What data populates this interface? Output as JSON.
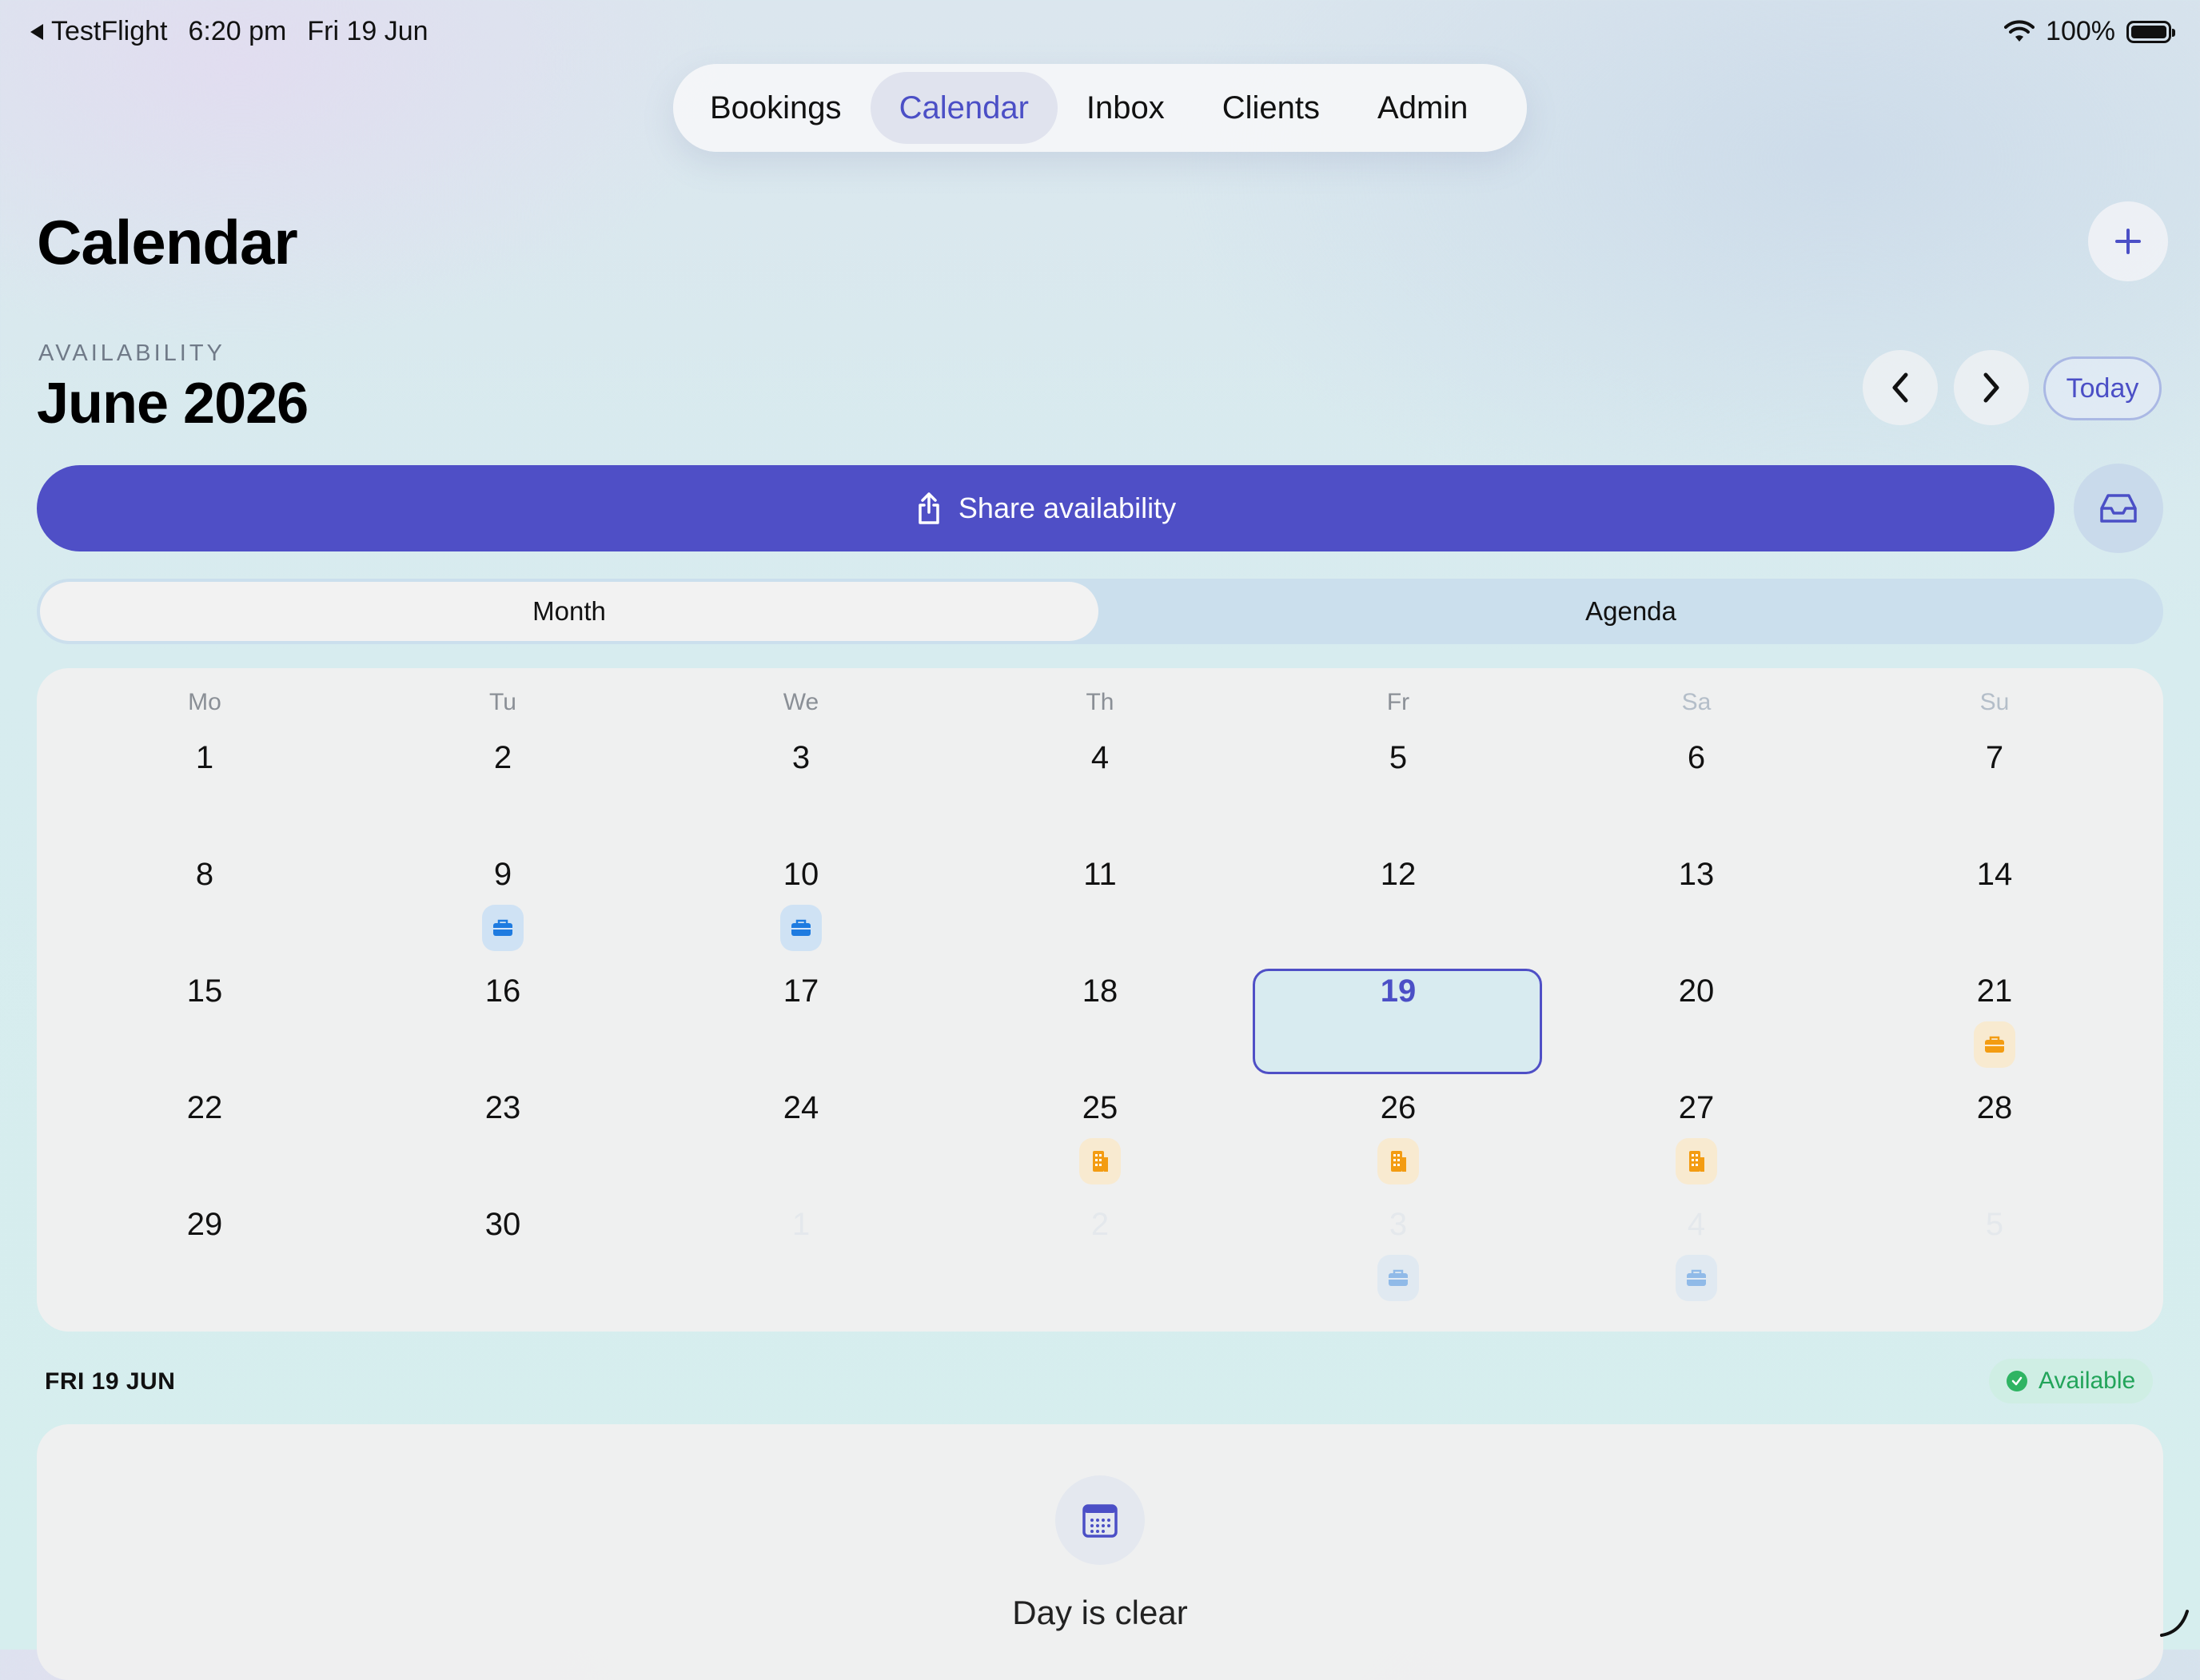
{
  "status_bar": {
    "back_app": "TestFlight",
    "time": "6:20 pm",
    "date": "Fri 19 Jun",
    "battery": "100%"
  },
  "tabs": [
    {
      "label": "Bookings",
      "active": false
    },
    {
      "label": "Calendar",
      "active": true
    },
    {
      "label": "Inbox",
      "active": false
    },
    {
      "label": "Clients",
      "active": false
    },
    {
      "label": "Admin",
      "active": false
    }
  ],
  "header": {
    "title": "Calendar",
    "add_icon": "plus-icon"
  },
  "month_nav": {
    "section_label": "AVAILABILITY",
    "month_title": "June 2026",
    "prev_icon": "chevron-left-icon",
    "next_icon": "chevron-right-icon",
    "today_label": "Today"
  },
  "share": {
    "label": "Share availability",
    "icon": "share-icon",
    "inbox_icon": "tray-icon"
  },
  "view_toggle": {
    "month_label": "Month",
    "agenda_label": "Agenda",
    "selected": "Month"
  },
  "calendar": {
    "weekdays": [
      "Mo",
      "Tu",
      "We",
      "Th",
      "Fr",
      "Sa",
      "Su"
    ],
    "weeks": [
      [
        "1",
        "2",
        "3",
        "4",
        "5",
        "6",
        "7"
      ],
      [
        "8",
        "9",
        "10",
        "11",
        "12",
        "13",
        "14"
      ],
      [
        "15",
        "16",
        "17",
        "18",
        "19",
        "20",
        "21"
      ],
      [
        "22",
        "23",
        "24",
        "25",
        "26",
        "27",
        "28"
      ],
      [
        "29",
        "30",
        "1",
        "2",
        "3",
        "4",
        "5"
      ]
    ],
    "selected_day": "19",
    "markers": [
      {
        "week": 1,
        "col": 1,
        "kind": "briefcase-icon",
        "color": "#1e7be0"
      },
      {
        "week": 1,
        "col": 2,
        "kind": "briefcase-icon",
        "color": "#1e7be0"
      },
      {
        "week": 2,
        "col": 6,
        "kind": "briefcase-icon",
        "color": "#f39c12"
      },
      {
        "week": 3,
        "col": 3,
        "kind": "building-icon",
        "color": "#f39c12"
      },
      {
        "week": 3,
        "col": 4,
        "kind": "building-icon",
        "color": "#f39c12"
      },
      {
        "week": 3,
        "col": 5,
        "kind": "building-icon",
        "color": "#f39c12"
      },
      {
        "week": 4,
        "col": 4,
        "kind": "briefcase-icon",
        "color": "#1e7be0",
        "faded": true
      },
      {
        "week": 4,
        "col": 5,
        "kind": "briefcase-icon",
        "color": "#1e7be0",
        "faded": true
      }
    ]
  },
  "day_detail": {
    "date_label": "FRI 19 JUN",
    "status": "Available",
    "status_color": "#22a45a",
    "empty_icon": "calendar-icon",
    "empty_text": "Day is clear"
  },
  "colors": {
    "accent": "#4f4fc6",
    "accent_text": "#4b4fc6"
  }
}
